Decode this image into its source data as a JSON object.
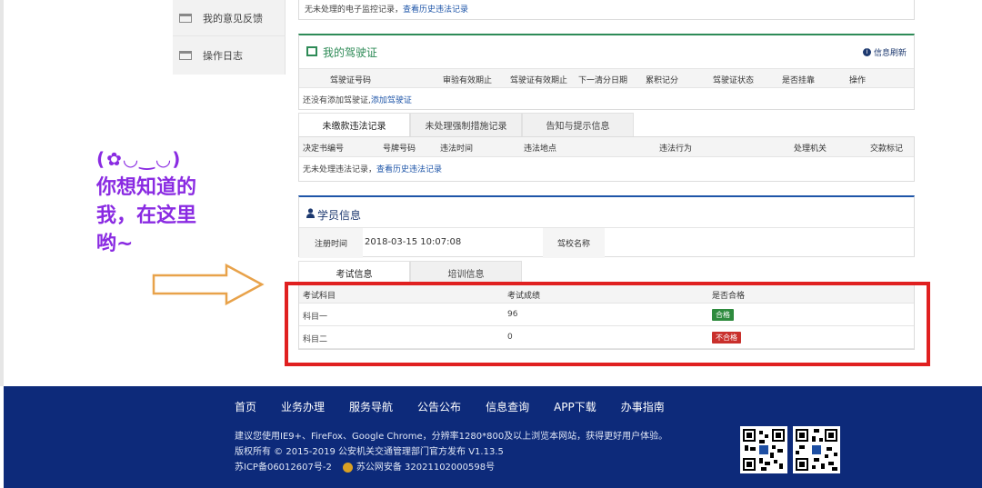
{
  "left_menu": [
    {
      "label": "我的意见反馈"
    },
    {
      "label": "操作日志"
    }
  ],
  "top_strip": {
    "text": "无未处理的电子监控记录，",
    "link": "查看历史违法记录"
  },
  "license_panel": {
    "title": "我的驾驶证",
    "refresh_label": "信息刷新",
    "columns": [
      "驾驶证号码",
      "审验有效期止",
      "驾驶证有效期止",
      "下一清分日期",
      "累积记分",
      "驾驶证状态",
      "是否挂靠",
      "操作"
    ],
    "empty_text": "还没有添加驾驶证,",
    "add_link": "添加驾驶证"
  },
  "record_tabs": [
    "未缴款违法记录",
    "未处理强制措施记录",
    "告知与提示信息"
  ],
  "violation_table": {
    "columns": [
      "决定书编号",
      "号牌号码",
      "违法时间",
      "违法地点",
      "违法行为",
      "处理机关",
      "交款标记"
    ],
    "empty_text": "无未处理违法记录，",
    "history_link": "查看历史违法记录"
  },
  "student_panel": {
    "title": "学员信息",
    "reg_time_label": "注册时间",
    "reg_time_value": "2018-03-15 10:07:08",
    "school_label": "驾校名称",
    "school_value": ""
  },
  "exam_tabs": [
    "考试信息",
    "培训信息"
  ],
  "exam_table": {
    "columns": [
      "考试科目",
      "考试成绩",
      "是否合格"
    ],
    "rows": [
      {
        "subject": "科目一",
        "score": "96",
        "result": "合格",
        "result_color": "#2e8b3e"
      },
      {
        "subject": "科目二",
        "score": "0",
        "result": "不合格",
        "result_color": "#c9302c"
      }
    ]
  },
  "annotation": {
    "face": "(✿◡‿◡)",
    "lines": [
      "你想知道的",
      "我，在这里",
      "哟~"
    ]
  },
  "footer": {
    "nav": [
      "首页",
      "业务办理",
      "服务导航",
      "公告公布",
      "信息查询",
      "APP下载",
      "办事指南"
    ],
    "browser_note": "建议您使用IE9+、FireFox、Google Chrome，分辨率1280*800及以上浏览本网站，获得更好用户体验。",
    "copyright": "版权所有 © 2015-2019 公安机关交通管理部门官方发布 V1.13.5",
    "icp": "苏ICP备06012607号-2",
    "police_record": "苏公网安备 32021102000598号"
  },
  "colors": {
    "footer_bg": "#0d2a7a",
    "highlight_box": "#e02020",
    "annotation": "#8a2be2",
    "license_accent": "#2e8b57"
  }
}
